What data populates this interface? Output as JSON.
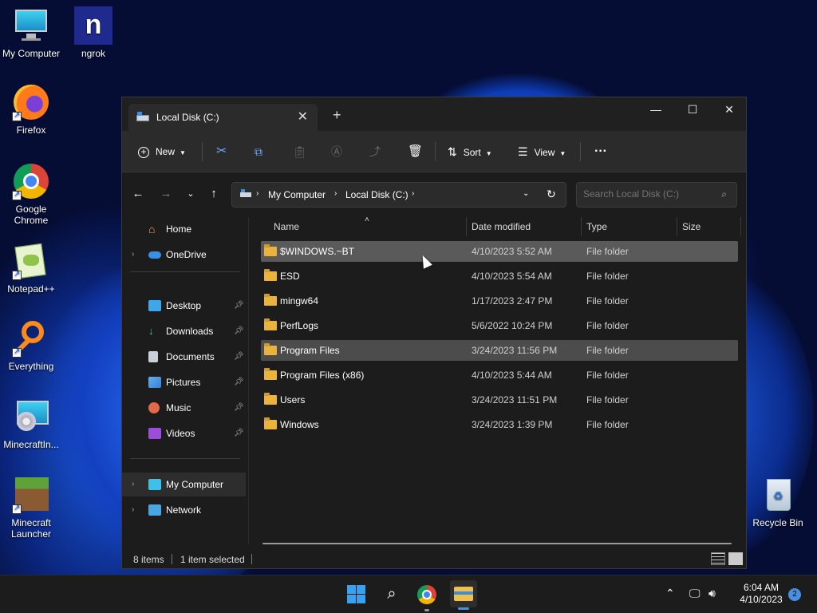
{
  "desktop": {
    "icons": [
      {
        "label": "My Computer",
        "icon": "computer-icon"
      },
      {
        "label": "ngrok",
        "icon": "ngrok-icon"
      },
      {
        "label": "Firefox",
        "icon": "firefox-icon"
      },
      {
        "label": "Google Chrome",
        "icon": "chrome-icon"
      },
      {
        "label": "Notepad++",
        "icon": "notepadpp-icon"
      },
      {
        "label": "Everything",
        "icon": "everything-icon"
      },
      {
        "label": "MinecraftIn...",
        "icon": "minecraft-installer-icon"
      },
      {
        "label": "Minecraft Launcher",
        "icon": "minecraft-launcher-icon"
      },
      {
        "label": "Recycle Bin",
        "icon": "recycle-bin-icon"
      }
    ]
  },
  "window": {
    "tab_title": "Local Disk (C:)",
    "new_tab": "+",
    "controls": {
      "minimize": "—",
      "maximize": "☐",
      "close": "✕"
    }
  },
  "toolbar": {
    "new_label": "New",
    "sort_label": "Sort",
    "view_label": "View",
    "more": "···"
  },
  "address": {
    "crumbs": [
      "My Computer",
      "Local Disk (C:)"
    ],
    "search_placeholder": "Search Local Disk (C:)"
  },
  "nav_pane": {
    "home": "Home",
    "onedrive": "OneDrive",
    "quick_access": [
      "Desktop",
      "Downloads",
      "Documents",
      "Pictures",
      "Music",
      "Videos"
    ],
    "my_computer": "My Computer",
    "network": "Network"
  },
  "columns": {
    "name": "Name",
    "date": "Date modified",
    "type": "Type",
    "size": "Size"
  },
  "files": [
    {
      "name": "$WINDOWS.~BT",
      "date": "4/10/2023 5:52 AM",
      "type": "File folder"
    },
    {
      "name": "ESD",
      "date": "4/10/2023 5:54 AM",
      "type": "File folder"
    },
    {
      "name": "mingw64",
      "date": "1/17/2023 2:47 PM",
      "type": "File folder"
    },
    {
      "name": "PerfLogs",
      "date": "5/6/2022 10:24 PM",
      "type": "File folder"
    },
    {
      "name": "Program Files",
      "date": "3/24/2023 11:56 PM",
      "type": "File folder"
    },
    {
      "name": "Program Files (x86)",
      "date": "4/10/2023 5:44 AM",
      "type": "File folder"
    },
    {
      "name": "Users",
      "date": "3/24/2023 11:51 PM",
      "type": "File folder"
    },
    {
      "name": "Windows",
      "date": "3/24/2023 1:39 PM",
      "type": "File folder"
    }
  ],
  "status": {
    "items": "8 items",
    "selected": "1 item selected"
  },
  "taskbar": {
    "time": "6:04 AM",
    "date": "4/10/2023",
    "notifications": "2"
  },
  "colors": {
    "folder": "#e9b33e",
    "accent": "#4a90e2",
    "selection": "#4c4c4c"
  }
}
